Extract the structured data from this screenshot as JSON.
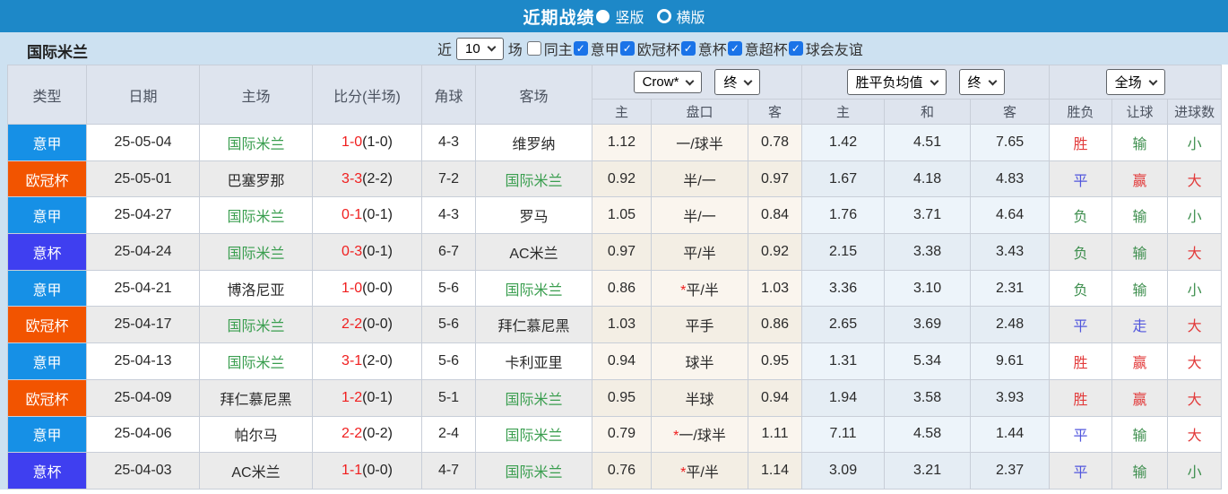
{
  "colors": {
    "topbar_bg": "#1d88c8",
    "filter_bg": "#cde1f1",
    "header_bg": "#dee4ee",
    "checkbox_blue": "#1a73e8",
    "badge_blue": "#1690e6",
    "badge_orange": "#f25400",
    "badge_purple": "#3f3ff0",
    "inter_green": "#3a9e4f",
    "score_red": "#f01e1e",
    "red": "#e23b3b",
    "green": "#3f8f4f",
    "draw_blue": "#5156dd"
  },
  "topbar": {
    "title": "近期战绩",
    "vertical_label": "竖版",
    "horizontal_label": "横版"
  },
  "filterbar": {
    "team": "国际米兰",
    "near_label": "近",
    "count_value": "10",
    "games_label": "场",
    "same_home_label": "同主",
    "leagues": [
      "意甲",
      "欧冠杯",
      "意杯",
      "意超杯",
      "球会友谊"
    ]
  },
  "table": {
    "selects": {
      "company": "Crow*",
      "time1": "终",
      "avg": "胜平负均值",
      "time2": "终",
      "scope": "全场"
    },
    "headers": {
      "type": "类型",
      "date": "日期",
      "home": "主场",
      "score": "比分(半场)",
      "corner": "角球",
      "away": "客场",
      "h_home": "主",
      "h_handicap": "盘口",
      "h_away": "客",
      "a_home": "主",
      "a_draw": "和",
      "a_away": "客",
      "r_wdl": "胜负",
      "r_handicap": "让球",
      "r_goals": "进球数"
    },
    "rows": [
      {
        "type": "意甲",
        "type_color": "blue",
        "date": "25-05-04",
        "home": "国际米兰",
        "home_inter": true,
        "score": "1-0",
        "half": "(1-0)",
        "corner": "4-3",
        "away": "维罗纳",
        "away_inter": false,
        "odds_home": "1.12",
        "handicap": "一/球半",
        "handicap_star": false,
        "odds_away": "0.78",
        "avg_home": "1.42",
        "avg_draw": "4.51",
        "avg_away": "7.65",
        "result": "胜",
        "result_color": "red",
        "handicap_result": "输",
        "handicap_result_color": "green",
        "goals": "小",
        "goals_color": "green"
      },
      {
        "type": "欧冠杯",
        "type_color": "orange",
        "date": "25-05-01",
        "home": "巴塞罗那",
        "home_inter": false,
        "score": "3-3",
        "half": "(2-2)",
        "corner": "7-2",
        "away": "国际米兰",
        "away_inter": true,
        "odds_home": "0.92",
        "handicap": "半/一",
        "handicap_star": false,
        "odds_away": "0.97",
        "avg_home": "1.67",
        "avg_draw": "4.18",
        "avg_away": "4.83",
        "result": "平",
        "result_color": "blue",
        "handicap_result": "赢",
        "handicap_result_color": "red",
        "goals": "大",
        "goals_color": "red"
      },
      {
        "type": "意甲",
        "type_color": "blue",
        "date": "25-04-27",
        "home": "国际米兰",
        "home_inter": true,
        "score": "0-1",
        "half": "(0-1)",
        "corner": "4-3",
        "away": "罗马",
        "away_inter": false,
        "odds_home": "1.05",
        "handicap": "半/一",
        "handicap_star": false,
        "odds_away": "0.84",
        "avg_home": "1.76",
        "avg_draw": "3.71",
        "avg_away": "4.64",
        "result": "负",
        "result_color": "green",
        "handicap_result": "输",
        "handicap_result_color": "green",
        "goals": "小",
        "goals_color": "green"
      },
      {
        "type": "意杯",
        "type_color": "purple",
        "date": "25-04-24",
        "home": "国际米兰",
        "home_inter": true,
        "score": "0-3",
        "half": "(0-1)",
        "corner": "6-7",
        "away": "AC米兰",
        "away_inter": false,
        "odds_home": "0.97",
        "handicap": "平/半",
        "handicap_star": false,
        "odds_away": "0.92",
        "avg_home": "2.15",
        "avg_draw": "3.38",
        "avg_away": "3.43",
        "result": "负",
        "result_color": "green",
        "handicap_result": "输",
        "handicap_result_color": "green",
        "goals": "大",
        "goals_color": "red"
      },
      {
        "type": "意甲",
        "type_color": "blue",
        "date": "25-04-21",
        "home": "博洛尼亚",
        "home_inter": false,
        "score": "1-0",
        "half": "(0-0)",
        "corner": "5-6",
        "away": "国际米兰",
        "away_inter": true,
        "odds_home": "0.86",
        "handicap": "平/半",
        "handicap_star": true,
        "odds_away": "1.03",
        "avg_home": "3.36",
        "avg_draw": "3.10",
        "avg_away": "2.31",
        "result": "负",
        "result_color": "green",
        "handicap_result": "输",
        "handicap_result_color": "green",
        "goals": "小",
        "goals_color": "green"
      },
      {
        "type": "欧冠杯",
        "type_color": "orange",
        "date": "25-04-17",
        "home": "国际米兰",
        "home_inter": true,
        "score": "2-2",
        "half": "(0-0)",
        "corner": "5-6",
        "away": "拜仁慕尼黑",
        "away_inter": false,
        "odds_home": "1.03",
        "handicap": "平手",
        "handicap_star": false,
        "odds_away": "0.86",
        "avg_home": "2.65",
        "avg_draw": "3.69",
        "avg_away": "2.48",
        "result": "平",
        "result_color": "blue",
        "handicap_result": "走",
        "handicap_result_color": "blue",
        "goals": "大",
        "goals_color": "red"
      },
      {
        "type": "意甲",
        "type_color": "blue",
        "date": "25-04-13",
        "home": "国际米兰",
        "home_inter": true,
        "score": "3-1",
        "half": "(2-0)",
        "corner": "5-6",
        "away": "卡利亚里",
        "away_inter": false,
        "odds_home": "0.94",
        "handicap": "球半",
        "handicap_star": false,
        "odds_away": "0.95",
        "avg_home": "1.31",
        "avg_draw": "5.34",
        "avg_away": "9.61",
        "result": "胜",
        "result_color": "red",
        "handicap_result": "赢",
        "handicap_result_color": "red",
        "goals": "大",
        "goals_color": "red"
      },
      {
        "type": "欧冠杯",
        "type_color": "orange",
        "date": "25-04-09",
        "home": "拜仁慕尼黑",
        "home_inter": false,
        "score": "1-2",
        "half": "(0-1)",
        "corner": "5-1",
        "away": "国际米兰",
        "away_inter": true,
        "odds_home": "0.95",
        "handicap": "半球",
        "handicap_star": false,
        "odds_away": "0.94",
        "avg_home": "1.94",
        "avg_draw": "3.58",
        "avg_away": "3.93",
        "result": "胜",
        "result_color": "red",
        "handicap_result": "赢",
        "handicap_result_color": "red",
        "goals": "大",
        "goals_color": "red"
      },
      {
        "type": "意甲",
        "type_color": "blue",
        "date": "25-04-06",
        "home": "帕尔马",
        "home_inter": false,
        "score": "2-2",
        "half": "(0-2)",
        "corner": "2-4",
        "away": "国际米兰",
        "away_inter": true,
        "odds_home": "0.79",
        "handicap": "一/球半",
        "handicap_star": true,
        "odds_away": "1.11",
        "avg_home": "7.11",
        "avg_draw": "4.58",
        "avg_away": "1.44",
        "result": "平",
        "result_color": "blue",
        "handicap_result": "输",
        "handicap_result_color": "green",
        "goals": "大",
        "goals_color": "red"
      },
      {
        "type": "意杯",
        "type_color": "purple",
        "date": "25-04-03",
        "home": "AC米兰",
        "home_inter": false,
        "score": "1-1",
        "half": "(0-0)",
        "corner": "4-7",
        "away": "国际米兰",
        "away_inter": true,
        "odds_home": "0.76",
        "handicap": "平/半",
        "handicap_star": true,
        "odds_away": "1.14",
        "avg_home": "3.09",
        "avg_draw": "3.21",
        "avg_away": "2.37",
        "result": "平",
        "result_color": "blue",
        "handicap_result": "输",
        "handicap_result_color": "green",
        "goals": "小",
        "goals_color": "green"
      }
    ]
  }
}
